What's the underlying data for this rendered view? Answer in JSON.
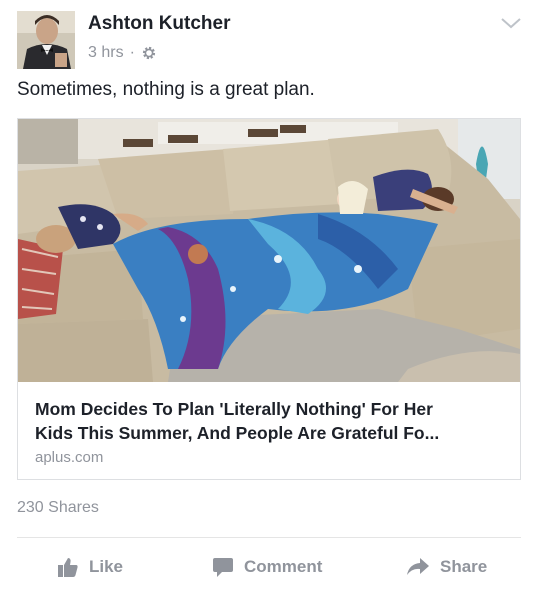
{
  "post": {
    "author_name": "Ashton Kutcher",
    "timestamp": "3 hrs",
    "separator": "·",
    "privacy_icon": "gear-icon",
    "menu_icon": "chevron-down-icon",
    "text": "Sometimes, nothing is a great plan."
  },
  "link_card": {
    "title_line1": "Mom Decides To Plan 'Literally Nothing' For Her",
    "title_line2": "Kids This Summer, And People Are Grateful Fo...",
    "domain": "aplus.com"
  },
  "engagement": {
    "shares_text": "230 Shares"
  },
  "actions": [
    {
      "label": "Like",
      "icon": "thumbs-up-icon"
    },
    {
      "label": "Comment",
      "icon": "comment-bubble-icon"
    },
    {
      "label": "Share",
      "icon": "share-arrow-icon"
    }
  ],
  "colors": {
    "primary_text": "#1d2129",
    "secondary_text": "#90949c",
    "border": "#dddfe2"
  }
}
